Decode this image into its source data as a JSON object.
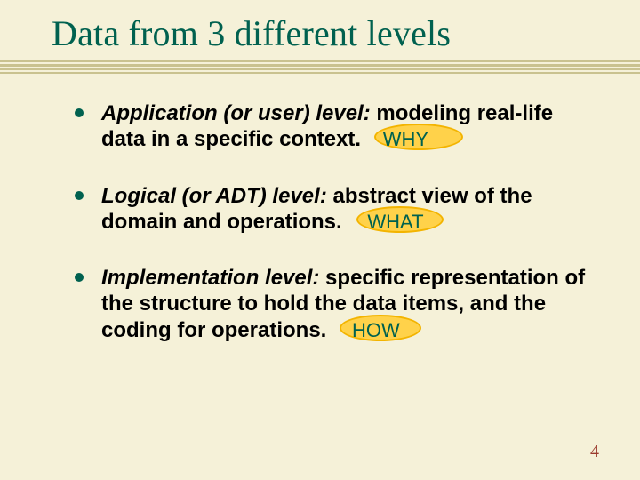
{
  "title": "Data from 3 different levels",
  "bullets": [
    {
      "label": "Application (or user) level:",
      "rest": " modeling real-life data in a specific context.",
      "callout": "WHY"
    },
    {
      "label": "Logical (or ADT) level:",
      "rest": " abstract view of the domain and operations.",
      "callout": "WHAT"
    },
    {
      "label": "Implementation level:",
      "rest": " specific representation of the structure to hold the data items, and the coding for operations.",
      "callout": "HOW"
    }
  ],
  "page_number": "4"
}
